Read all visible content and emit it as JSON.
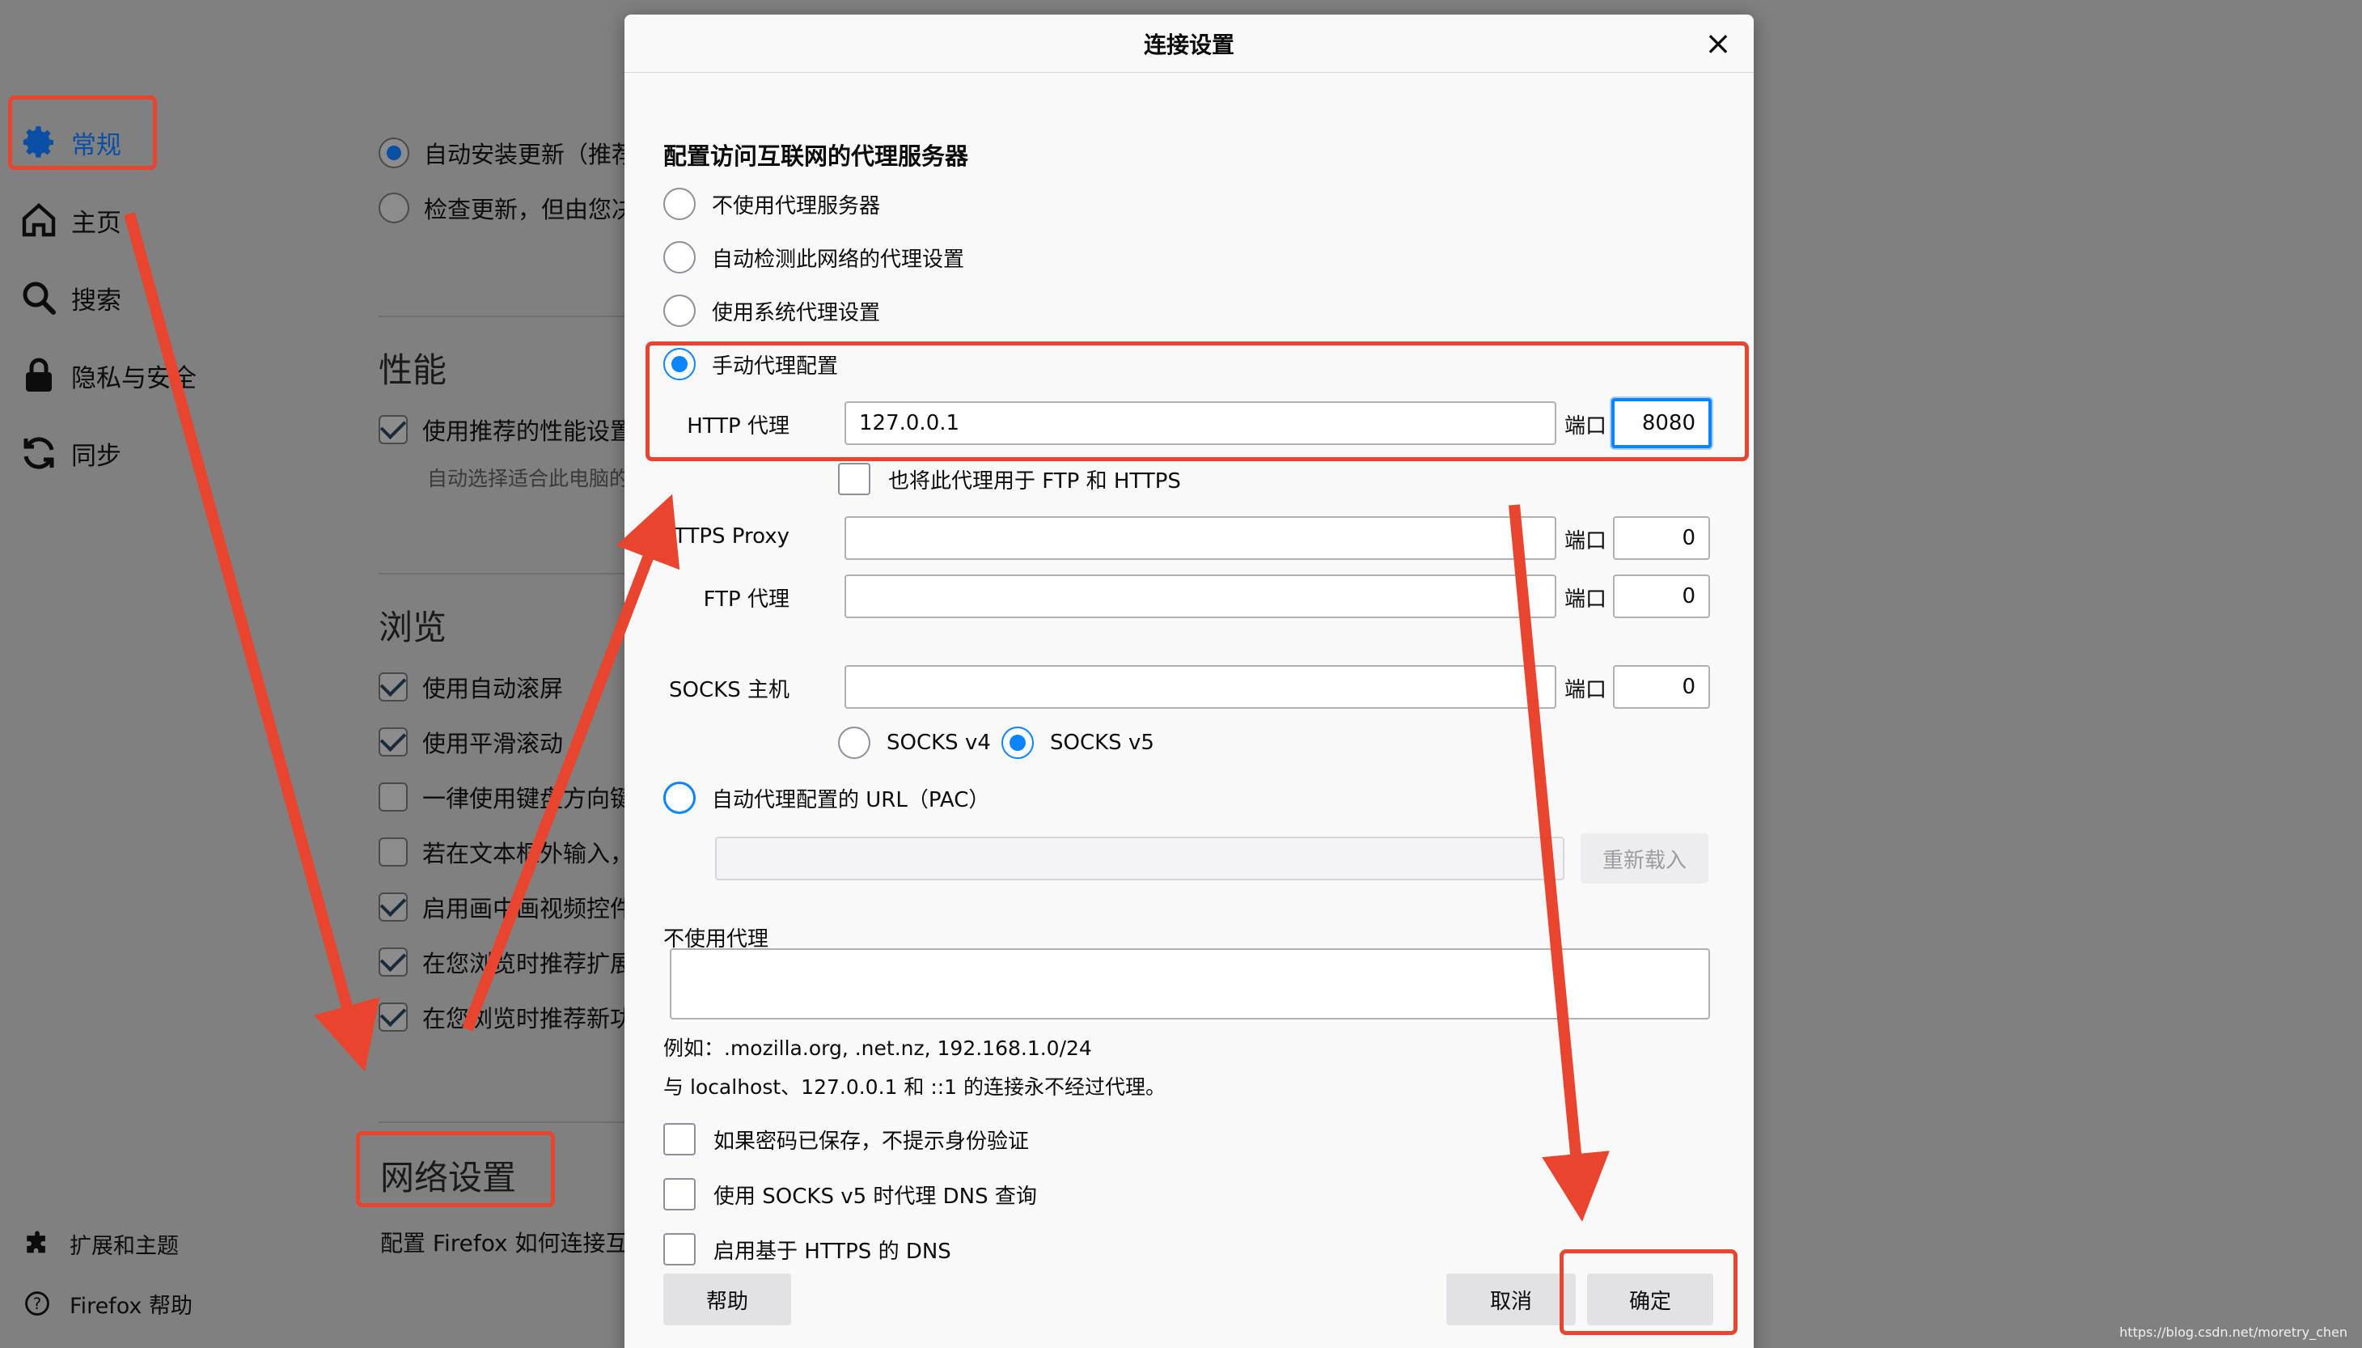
{
  "sidebar": {
    "items": [
      {
        "label": "常规",
        "icon": "gear-icon",
        "active": true
      },
      {
        "label": "主页",
        "icon": "home-icon"
      },
      {
        "label": "搜索",
        "icon": "search-icon"
      },
      {
        "label": "隐私与安全",
        "icon": "lock-icon"
      },
      {
        "label": "同步",
        "icon": "sync-icon"
      }
    ],
    "footer": [
      {
        "label": "扩展和主题",
        "icon": "puzzle-icon"
      },
      {
        "label": "Firefox 帮助",
        "icon": "help-icon"
      }
    ]
  },
  "prefs": {
    "updates": {
      "auto_install": "自动安装更新（推荐",
      "check_only": "检查更新，但由您决定"
    },
    "performance": {
      "heading": "性能",
      "use_recommended": "使用推荐的性能设置",
      "sub": "自动选择适合此电脑的"
    },
    "browsing": {
      "heading": "浏览",
      "items": [
        {
          "label": "使用自动滚屏",
          "checked": true
        },
        {
          "label": "使用平滑滚动",
          "checked": true
        },
        {
          "label": "一律使用键盘方向键",
          "checked": false
        },
        {
          "label": "若在文本框外输入，",
          "checked": false
        },
        {
          "label": "启用画中画视频控件",
          "checked": true
        },
        {
          "label": "在您浏览时推荐扩展",
          "checked": true
        },
        {
          "label": "在您浏览时推荐新功能",
          "checked": true
        }
      ]
    },
    "network": {
      "heading": "网络设置",
      "desc": "配置 Firefox 如何连接互联网"
    }
  },
  "dialog": {
    "title": "连接设置",
    "close": "×",
    "section_heading": "配置访问互联网的代理服务器",
    "proxy_options": {
      "none": "不使用代理服务器",
      "auto_detect": "自动检测此网络的代理设置",
      "system": "使用系统代理设置",
      "manual": "手动代理配置",
      "pac": "自动代理配置的 URL（PAC）"
    },
    "selected_option": "manual",
    "http": {
      "label": "HTTP 代理",
      "host": "127.0.0.1",
      "port_label": "端口",
      "port": "8080"
    },
    "also_use": "也将此代理用于 FTP 和 HTTPS",
    "https": {
      "label": "HTTPS Proxy",
      "host": "",
      "port_label": "端口",
      "port": "0"
    },
    "ftp": {
      "label": "FTP 代理",
      "host": "",
      "port_label": "端口",
      "port": "0"
    },
    "socks": {
      "label": "SOCKS 主机",
      "host": "",
      "port_label": "端口",
      "port": "0",
      "v4": "SOCKS v4",
      "v5": "SOCKS v5",
      "selected": "v5"
    },
    "pac_url": "",
    "reload_button": "重新载入",
    "no_proxy_label": "不使用代理",
    "no_proxy_value": "",
    "example": "例如：.mozilla.org, .net.nz, 192.168.1.0/24",
    "localhost_note": "与 localhost、127.0.0.1 和 ::1 的连接永不经过代理。",
    "options": {
      "no_auth_prompt": "如果密码已保存，不提示身份验证",
      "socks_dns": "使用 SOCKS v5 时代理 DNS 查询",
      "https_dns": "启用基于 HTTPS 的 DNS"
    },
    "buttons": {
      "help": "帮助",
      "cancel": "取消",
      "ok": "确定"
    }
  },
  "annotation_color": "#e8442e",
  "watermark": "https://blog.csdn.net/moretry_chen"
}
